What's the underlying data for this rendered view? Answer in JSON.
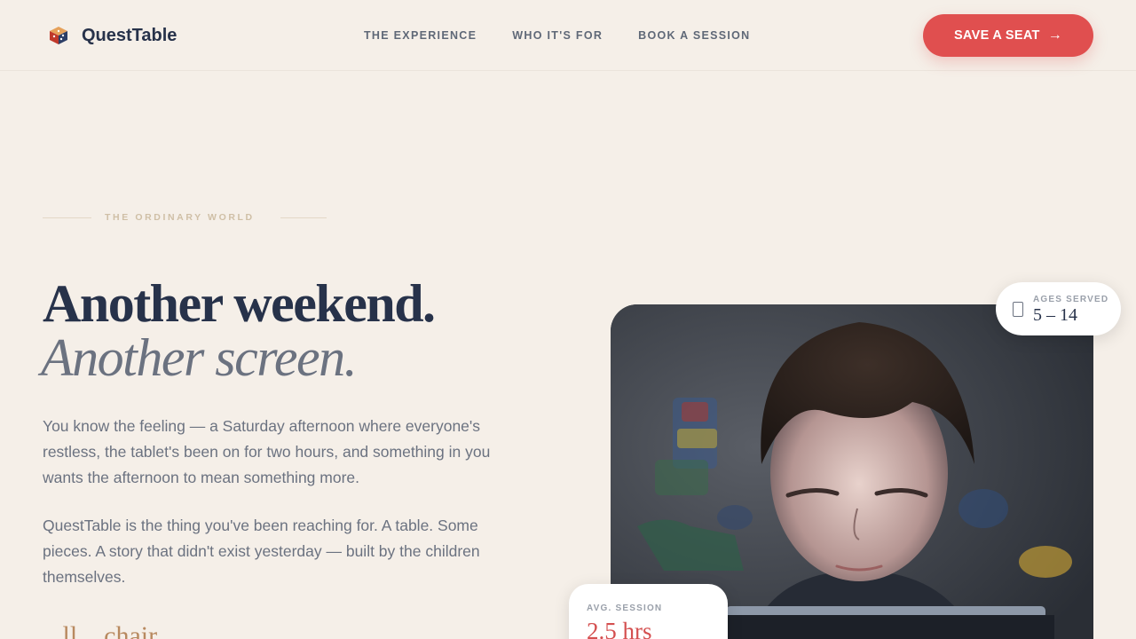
{
  "brand": {
    "name": "QuestTable",
    "logo_icon": "dice-cube-icon"
  },
  "nav": {
    "items": [
      {
        "label": "THE EXPERIENCE"
      },
      {
        "label": "WHO IT'S FOR"
      },
      {
        "label": "BOOK A SESSION"
      }
    ]
  },
  "cta": {
    "label": "SAVE A SEAT",
    "icon": "arrow-right-icon",
    "arrow": "→",
    "color": "#e04f4f"
  },
  "hero": {
    "eyebrow": "THE ORDINARY WORLD",
    "headline_line1": "Another weekend.",
    "headline_line2": "Another screen.",
    "paragraph1": "You know the feeling — a Saturday afternoon where everyone's restless, the tablet's been on for two hours, and something in you wants the afternoon to mean something more.",
    "paragraph2": "QuestTable is the thing you've been reaching for. A table. Some pieces. A story that didn't exist yesterday — built by the children themselves.",
    "script_text": "...ll... chair"
  },
  "stats": {
    "ages": {
      "label": "AGES SERVED",
      "value": "5 – 14",
      "icon": "tablet-icon"
    },
    "session": {
      "label": "AVG. SESSION",
      "value": "2.5 hrs"
    }
  },
  "colors": {
    "background": "#f5efe8",
    "heading": "#27324a",
    "muted": "#6b7280",
    "accent": "#e04f4f"
  }
}
